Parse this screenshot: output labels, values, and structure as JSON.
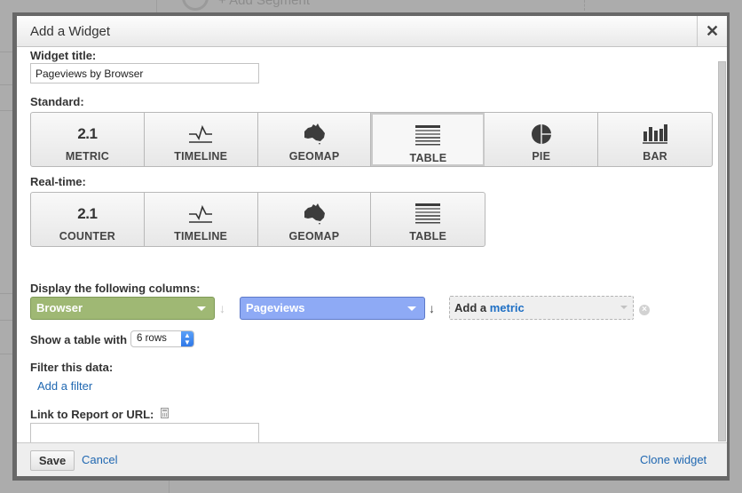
{
  "background": {
    "segment_label": "+ Add Segment"
  },
  "dialog": {
    "title": "Add a Widget",
    "close_icon": "close-icon",
    "widget_title": {
      "label": "Widget title:",
      "value": "Pageviews by Browser"
    },
    "standard": {
      "label": "Standard:",
      "options": [
        {
          "label": "METRIC",
          "icon": "metric-2.1-icon",
          "icon_text": "2.1",
          "selected": false
        },
        {
          "label": "TIMELINE",
          "icon": "timeline-icon",
          "selected": false
        },
        {
          "label": "GEOMAP",
          "icon": "australia-map-icon",
          "selected": false
        },
        {
          "label": "TABLE",
          "icon": "table-icon",
          "selected": true
        },
        {
          "label": "PIE",
          "icon": "pie-icon",
          "selected": false
        },
        {
          "label": "BAR",
          "icon": "bar-chart-icon",
          "selected": false
        }
      ]
    },
    "realtime": {
      "label": "Real-time:",
      "options": [
        {
          "label": "COUNTER",
          "icon": "counter-2.1-icon",
          "icon_text": "2.1"
        },
        {
          "label": "TIMELINE",
          "icon": "timeline-icon"
        },
        {
          "label": "GEOMAP",
          "icon": "australia-map-icon"
        },
        {
          "label": "TABLE",
          "icon": "table-icon"
        }
      ]
    },
    "columns": {
      "label": "Display the following columns:",
      "dimension": {
        "value": "Browser",
        "color": "#9fb874"
      },
      "metric": {
        "value": "Pageviews",
        "color": "#8eaaf5"
      },
      "add_metric": {
        "prefix": "Add a",
        "link": "metric"
      }
    },
    "rows": {
      "label": "Show a table with",
      "value": "6 rows"
    },
    "filter": {
      "label": "Filter this data:",
      "add_filter": "Add a filter"
    },
    "link": {
      "label": "Link to Report or URL:",
      "value": ""
    },
    "footer": {
      "save": "Save",
      "cancel": "Cancel",
      "clone": "Clone widget"
    }
  }
}
